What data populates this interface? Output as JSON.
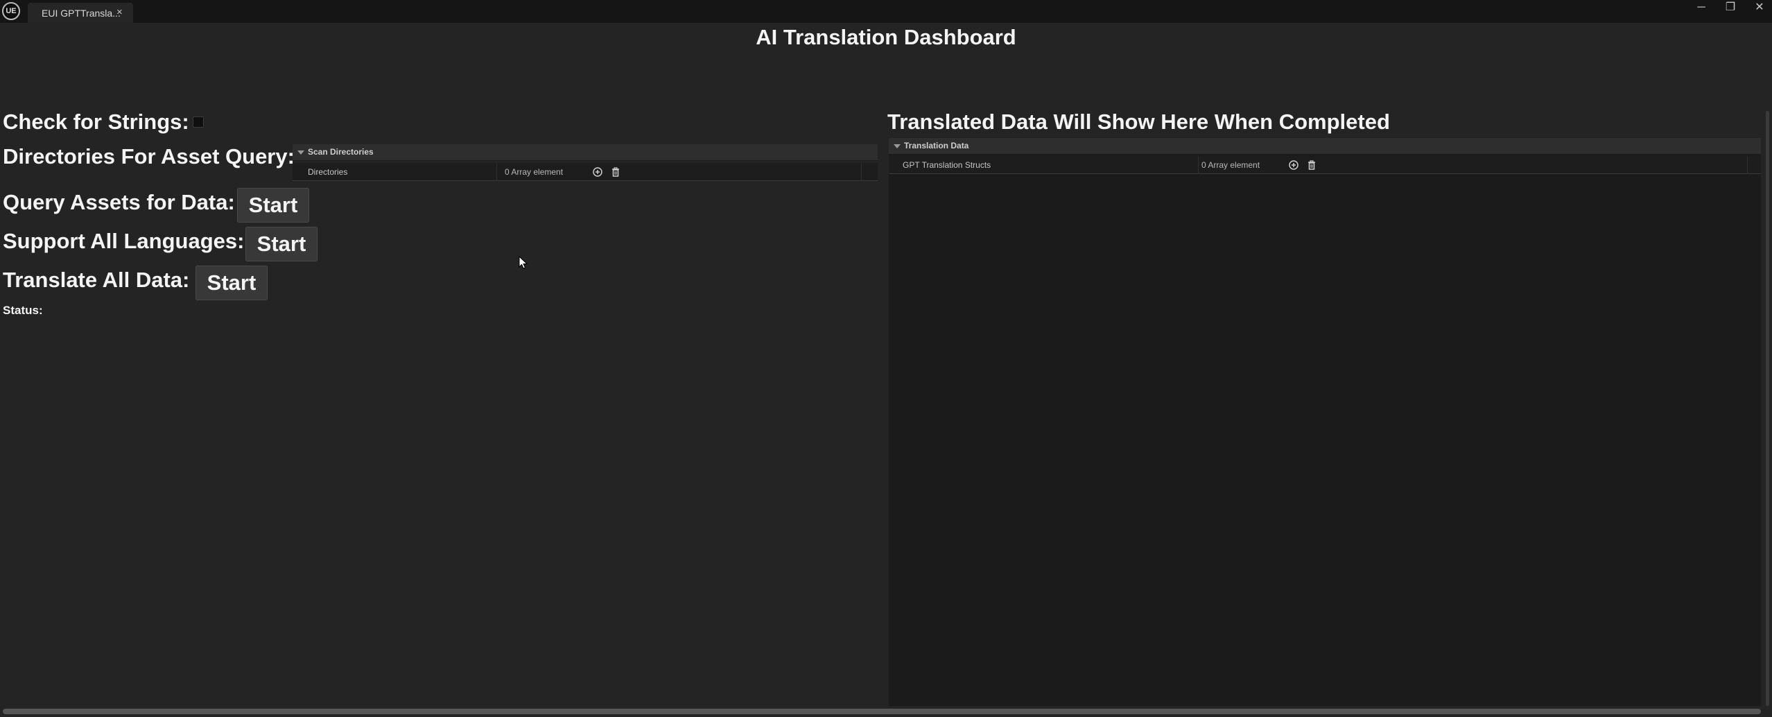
{
  "window": {
    "tab_title": "EUI GPTTransla...",
    "tab_close_glyph": "×",
    "minimize_glyph": "─",
    "restore_glyph": "❐",
    "close_glyph": "✕",
    "logo_icon": "unreal-engine-logo-icon"
  },
  "main": {
    "title": "AI Translation Dashboard"
  },
  "left": {
    "check_for_strings_label": "Check for Strings:",
    "directories_label": "Directories For Asset Query:",
    "query_assets_label": "Query Assets for Data:",
    "query_assets_button": "Start",
    "support_languages_label": "Support All Languages:",
    "support_languages_button": "Start",
    "translate_all_label": "Translate All Data:",
    "translate_all_button": "Start",
    "status_label": "Status:",
    "scan_panel": {
      "header": "Scan Directories",
      "property_name": "Directories",
      "property_value": "0 Array element"
    }
  },
  "right": {
    "heading": "Translated Data Will Show Here When Completed",
    "panel": {
      "header": "Translation Data",
      "property_name": "GPT Translation Structs",
      "property_value": "0 Array element"
    }
  },
  "colors": {
    "background": "#242424",
    "titlebar": "#151515",
    "button": "#383838",
    "panel_header": "#2e2e2e",
    "panel_row": "#1d1d1d"
  }
}
